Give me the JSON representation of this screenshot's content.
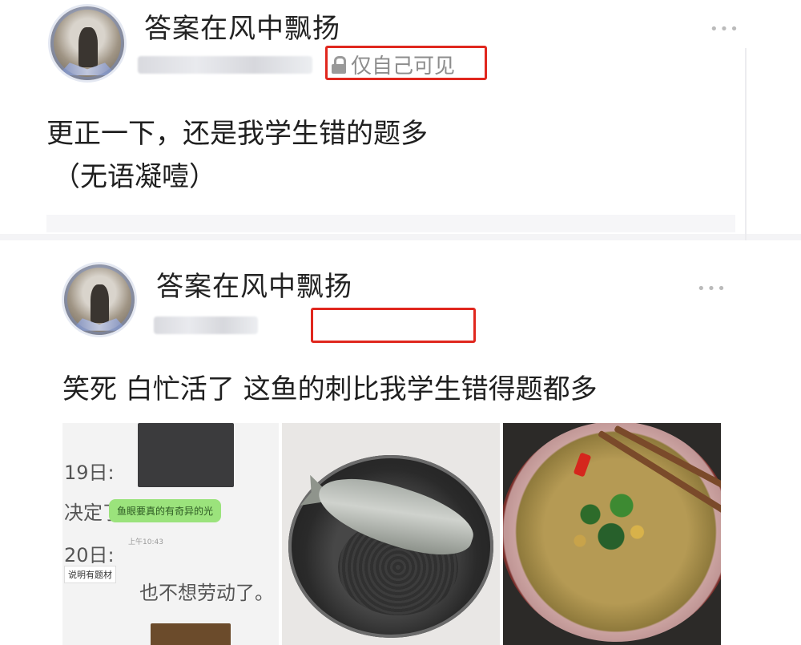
{
  "posts": [
    {
      "username": "答案在风中飘扬",
      "visibility": "仅自己可见",
      "text_lines": [
        "更正一下，还是我学生错的题多",
        "（无语凝噎）"
      ]
    },
    {
      "username": "答案在风中飘扬",
      "visibility": "",
      "text_lines": [
        "笑死 白忙活了 这鱼的刺比我学生错得题都多"
      ]
    }
  ],
  "photo1": {
    "date1": "19日:",
    "line1": "决定了",
    "bubble": "鱼眼要真的有奇异的光",
    "date2": "20日:",
    "tag": "说明有题材",
    "time1": "上午10:43",
    "line2": "也不想劳动了。"
  },
  "colors": {
    "highlight_box": "#e0271e",
    "text": "#1f1f1f",
    "muted": "#8d8d8d"
  },
  "icons": {
    "lock": "lock-icon",
    "more": "more-icon"
  },
  "more_glyph": "•••"
}
